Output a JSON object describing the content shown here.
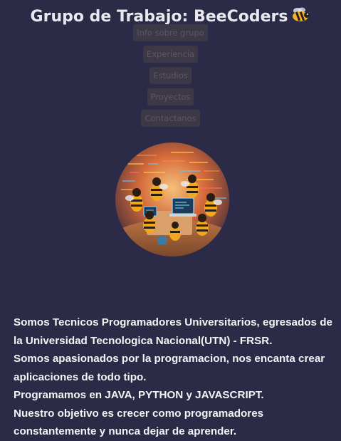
{
  "header": {
    "title": "Grupo de Trabajo: BeeCoders"
  },
  "nav": {
    "items": [
      {
        "label": "Info sobre grupo"
      },
      {
        "label": "Experiencia"
      },
      {
        "label": "Estudios"
      },
      {
        "label": "Proyectos"
      },
      {
        "label": "Contactanos"
      }
    ]
  },
  "hero": {
    "icon": "bees-coding-illustration"
  },
  "about": {
    "lines": [
      "Somos Tecnicos Programadores Universitarios, egresados de la Universidad Tecnologica Nacional(UTN) - FRSR.",
      "Somos apasionados por la programacion, nos encanta crear aplicaciones de todo tipo.",
      "Programamos en JAVA, PYTHON y JAVASCRIPT.",
      "Nuestro objetivo es crecer como programadores constantemente y nunca dejar de aprender."
    ]
  },
  "colors": {
    "background": "#2b2a47",
    "nav_bg": "#3d3845",
    "nav_text": "#5d5667",
    "accent": "#f3a623"
  }
}
